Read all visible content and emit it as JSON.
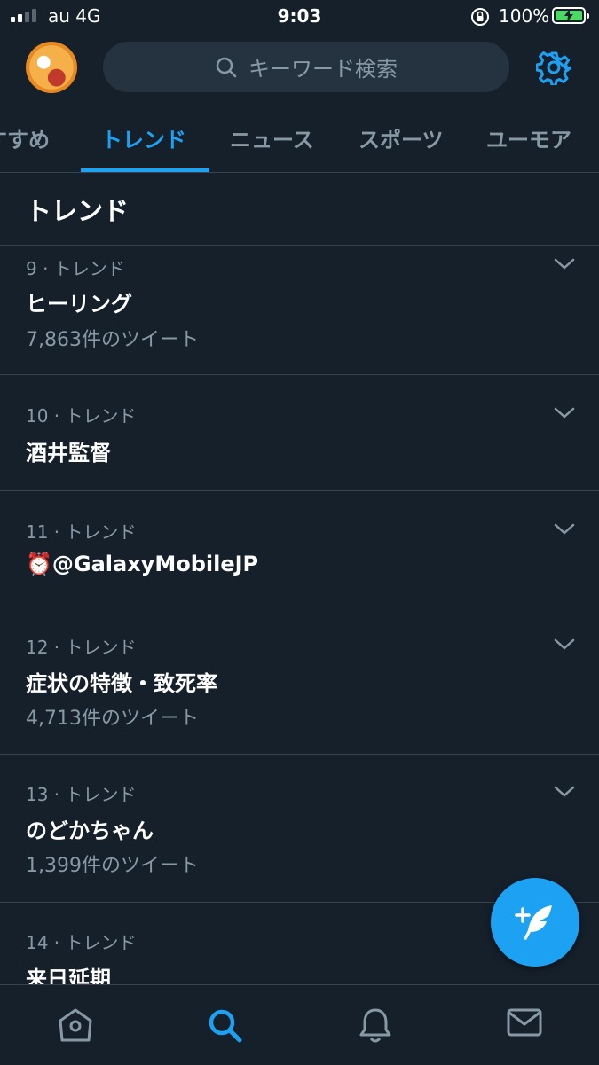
{
  "status_bar": {
    "carrier": "au 4G",
    "time": "9:03",
    "battery": "100%"
  },
  "header": {
    "search_placeholder": "キーワード検索"
  },
  "tabs": [
    {
      "label": "すすめ"
    },
    {
      "label": "トレンド",
      "active": true
    },
    {
      "label": "ニュース"
    },
    {
      "label": "スポーツ"
    },
    {
      "label": "ユーモア"
    }
  ],
  "section_title": "トレンド",
  "trends": [
    {
      "meta": "9 · トレンド",
      "name": "ヒーリング",
      "count": "7,863件のツイート"
    },
    {
      "meta": "10 · トレンド",
      "name": "酒井監督",
      "count": ""
    },
    {
      "meta": "11 · トレンド",
      "name": "⏰@GalaxyMobileJP",
      "count": ""
    },
    {
      "meta": "12 · トレンド",
      "name": "症状の特徴・致死率",
      "count": "4,713件のツイート"
    },
    {
      "meta": "13 · トレンド",
      "name": "のどかちゃん",
      "count": "1,399件のツイート"
    },
    {
      "meta": "14 · トレンド",
      "name": "来日延期",
      "count": ""
    }
  ],
  "colors": {
    "background": "#15202b",
    "accent": "#1da1f2",
    "muted": "#8899a6",
    "divider": "#38444d"
  },
  "icons": {
    "header": [
      "avatar",
      "search-icon",
      "gear-icon"
    ],
    "trend_row": "chevron-down-icon",
    "fab": "compose-icon",
    "bottom_nav": [
      "home-icon",
      "search-icon",
      "bell-icon",
      "mail-icon"
    ]
  }
}
